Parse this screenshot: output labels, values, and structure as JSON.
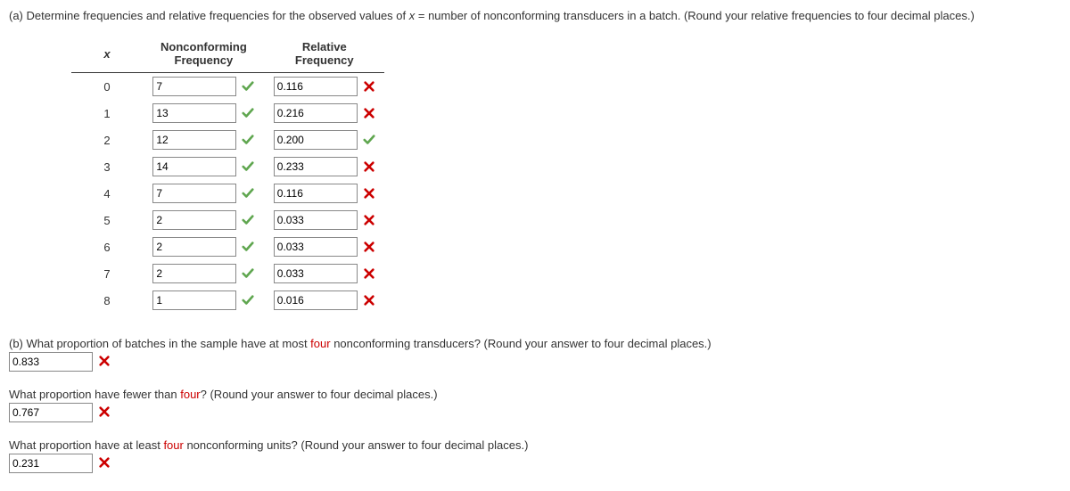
{
  "partA": {
    "prompt_prefix": "(a) Determine frequencies and relative frequencies for the observed values of ",
    "var": "x",
    "prompt_suffix": " = number of nonconforming transducers in a batch. (Round your relative frequencies to four decimal places.)",
    "headers": {
      "x": "x",
      "nonconf": "Nonconforming Frequency",
      "rel": "Relative Frequency"
    },
    "rows": [
      {
        "x": "0",
        "freq": "7",
        "freq_ok": true,
        "rel": "0.116",
        "rel_ok": false
      },
      {
        "x": "1",
        "freq": "13",
        "freq_ok": true,
        "rel": "0.216",
        "rel_ok": false
      },
      {
        "x": "2",
        "freq": "12",
        "freq_ok": true,
        "rel": "0.200",
        "rel_ok": true
      },
      {
        "x": "3",
        "freq": "14",
        "freq_ok": true,
        "rel": "0.233",
        "rel_ok": false
      },
      {
        "x": "4",
        "freq": "7",
        "freq_ok": true,
        "rel": "0.116",
        "rel_ok": false
      },
      {
        "x": "5",
        "freq": "2",
        "freq_ok": true,
        "rel": "0.033",
        "rel_ok": false
      },
      {
        "x": "6",
        "freq": "2",
        "freq_ok": true,
        "rel": "0.033",
        "rel_ok": false
      },
      {
        "x": "7",
        "freq": "2",
        "freq_ok": true,
        "rel": "0.033",
        "rel_ok": false
      },
      {
        "x": "8",
        "freq": "1",
        "freq_ok": true,
        "rel": "0.016",
        "rel_ok": false
      }
    ]
  },
  "partB": {
    "q1_prefix": "(b) What proportion of batches in the sample have at most ",
    "q1_highlight": "four",
    "q1_suffix": " nonconforming transducers? (Round your answer to four decimal places.)",
    "q1_value": "0.833",
    "q1_ok": false,
    "q2_prefix": "What proportion have fewer than ",
    "q2_highlight": "four",
    "q2_suffix": "? (Round your answer to four decimal places.)",
    "q2_value": "0.767",
    "q2_ok": false,
    "q3_prefix": "What proportion have at least ",
    "q3_highlight": "four",
    "q3_suffix": " nonconforming units? (Round your answer to four decimal places.)",
    "q3_value": "0.231",
    "q3_ok": false
  }
}
